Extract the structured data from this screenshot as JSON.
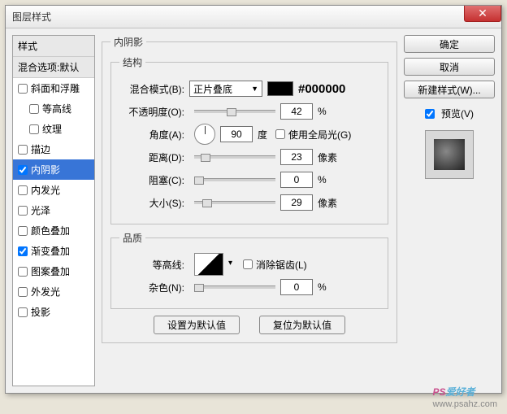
{
  "window": {
    "title": "图层样式"
  },
  "sidebar": {
    "header": "样式",
    "blend_header": "混合选项:默认",
    "items": [
      {
        "label": "斜面和浮雕",
        "checked": false,
        "indent": false
      },
      {
        "label": "等高线",
        "checked": false,
        "indent": true
      },
      {
        "label": "纹理",
        "checked": false,
        "indent": true
      },
      {
        "label": "描边",
        "checked": false,
        "indent": false
      },
      {
        "label": "内阴影",
        "checked": true,
        "indent": false,
        "selected": true
      },
      {
        "label": "内发光",
        "checked": false,
        "indent": false
      },
      {
        "label": "光泽",
        "checked": false,
        "indent": false
      },
      {
        "label": "颜色叠加",
        "checked": false,
        "indent": false
      },
      {
        "label": "渐变叠加",
        "checked": true,
        "indent": false
      },
      {
        "label": "图案叠加",
        "checked": false,
        "indent": false
      },
      {
        "label": "外发光",
        "checked": false,
        "indent": false
      },
      {
        "label": "投影",
        "checked": false,
        "indent": false
      }
    ]
  },
  "main": {
    "title": "内阴影",
    "structure_title": "结构",
    "blend_mode_label": "混合模式(B):",
    "blend_mode_value": "正片叠底",
    "color_hex": "#000000",
    "opacity_label": "不透明度(O):",
    "opacity_value": "42",
    "percent": "%",
    "angle_label": "角度(A):",
    "angle_value": "90",
    "degree": "度",
    "global_light_label": "使用全局光(G)",
    "distance_label": "距离(D):",
    "distance_value": "23",
    "px": "像素",
    "choke_label": "阻塞(C):",
    "choke_value": "0",
    "size_label": "大小(S):",
    "size_value": "29",
    "quality_title": "品质",
    "contour_label": "等高线:",
    "antialiased_label": "消除锯齿(L)",
    "noise_label": "杂色(N):",
    "noise_value": "0",
    "set_default": "设置为默认值",
    "reset_default": "复位为默认值"
  },
  "right": {
    "ok": "确定",
    "cancel": "取消",
    "new_style": "新建样式(W)...",
    "preview": "预览(V)"
  },
  "watermark": {
    "ps": "PS",
    "text": "爱好者",
    "url": "www.psahz.com"
  }
}
